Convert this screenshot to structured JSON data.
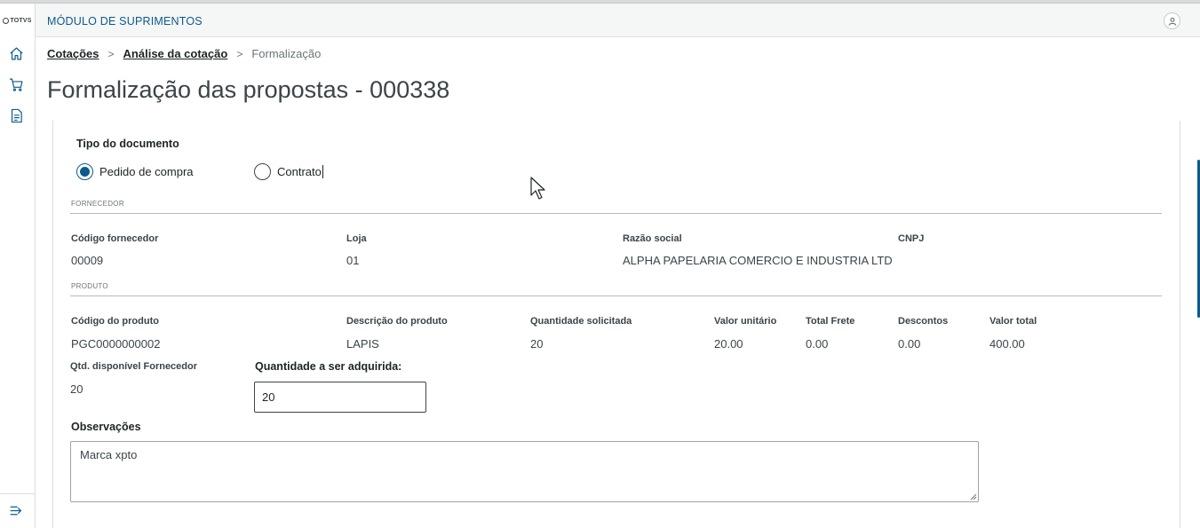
{
  "brand": {
    "logo_text": "TOTVS"
  },
  "header": {
    "title": "MÓDULO DE SUPRIMENTOS"
  },
  "sidebar": {
    "items": [
      {
        "icon": "home-icon"
      },
      {
        "icon": "cart-icon"
      },
      {
        "icon": "document-icon"
      }
    ],
    "footer_icon": "collapse-menu-icon"
  },
  "breadcrumb": {
    "items": [
      "Cotações",
      "Análise da cotação"
    ],
    "current": "Formalização",
    "separator": ">"
  },
  "page": {
    "title": "Formalização das propostas - 000338"
  },
  "form": {
    "doc_type_label": "Tipo do documento",
    "options": [
      "Pedido de compra",
      "Contrato"
    ],
    "selected": "Pedido de compra"
  },
  "supplier": {
    "section": "FORNECEDOR",
    "labels": {
      "code": "Código fornecedor",
      "store": "Loja",
      "name": "Razão social",
      "cnpj": "CNPJ"
    },
    "values": {
      "code": "00009",
      "store": "01",
      "name": "ALPHA PAPELARIA COMERCIO E INDUSTRIA LTD",
      "cnpj": ""
    }
  },
  "product": {
    "section": "PRODUTO",
    "labels": {
      "code": "Código do produto",
      "description": "Descrição do produto",
      "qty_requested": "Quantidade solicitada",
      "unit_price": "Valor unitário",
      "freight": "Total Frete",
      "discounts": "Descontos",
      "total": "Valor total",
      "qty_available": "Qtd. disponível Fornecedor",
      "qty_to_buy": "Quantidade a ser adquirida"
    },
    "values": {
      "code": "PGC0000000002",
      "description": "LAPIS",
      "qty_requested": "20",
      "unit_price": "20.00",
      "freight": "0.00",
      "discounts": "0.00",
      "total": "400.00",
      "qty_available": "20",
      "qty_to_buy": "20"
    }
  },
  "observations": {
    "label": "Observações",
    "value": "Marca xpto"
  },
  "colors": {
    "primary": "#0c5b8b",
    "text": "#1d2426",
    "muted": "#6c7478"
  }
}
